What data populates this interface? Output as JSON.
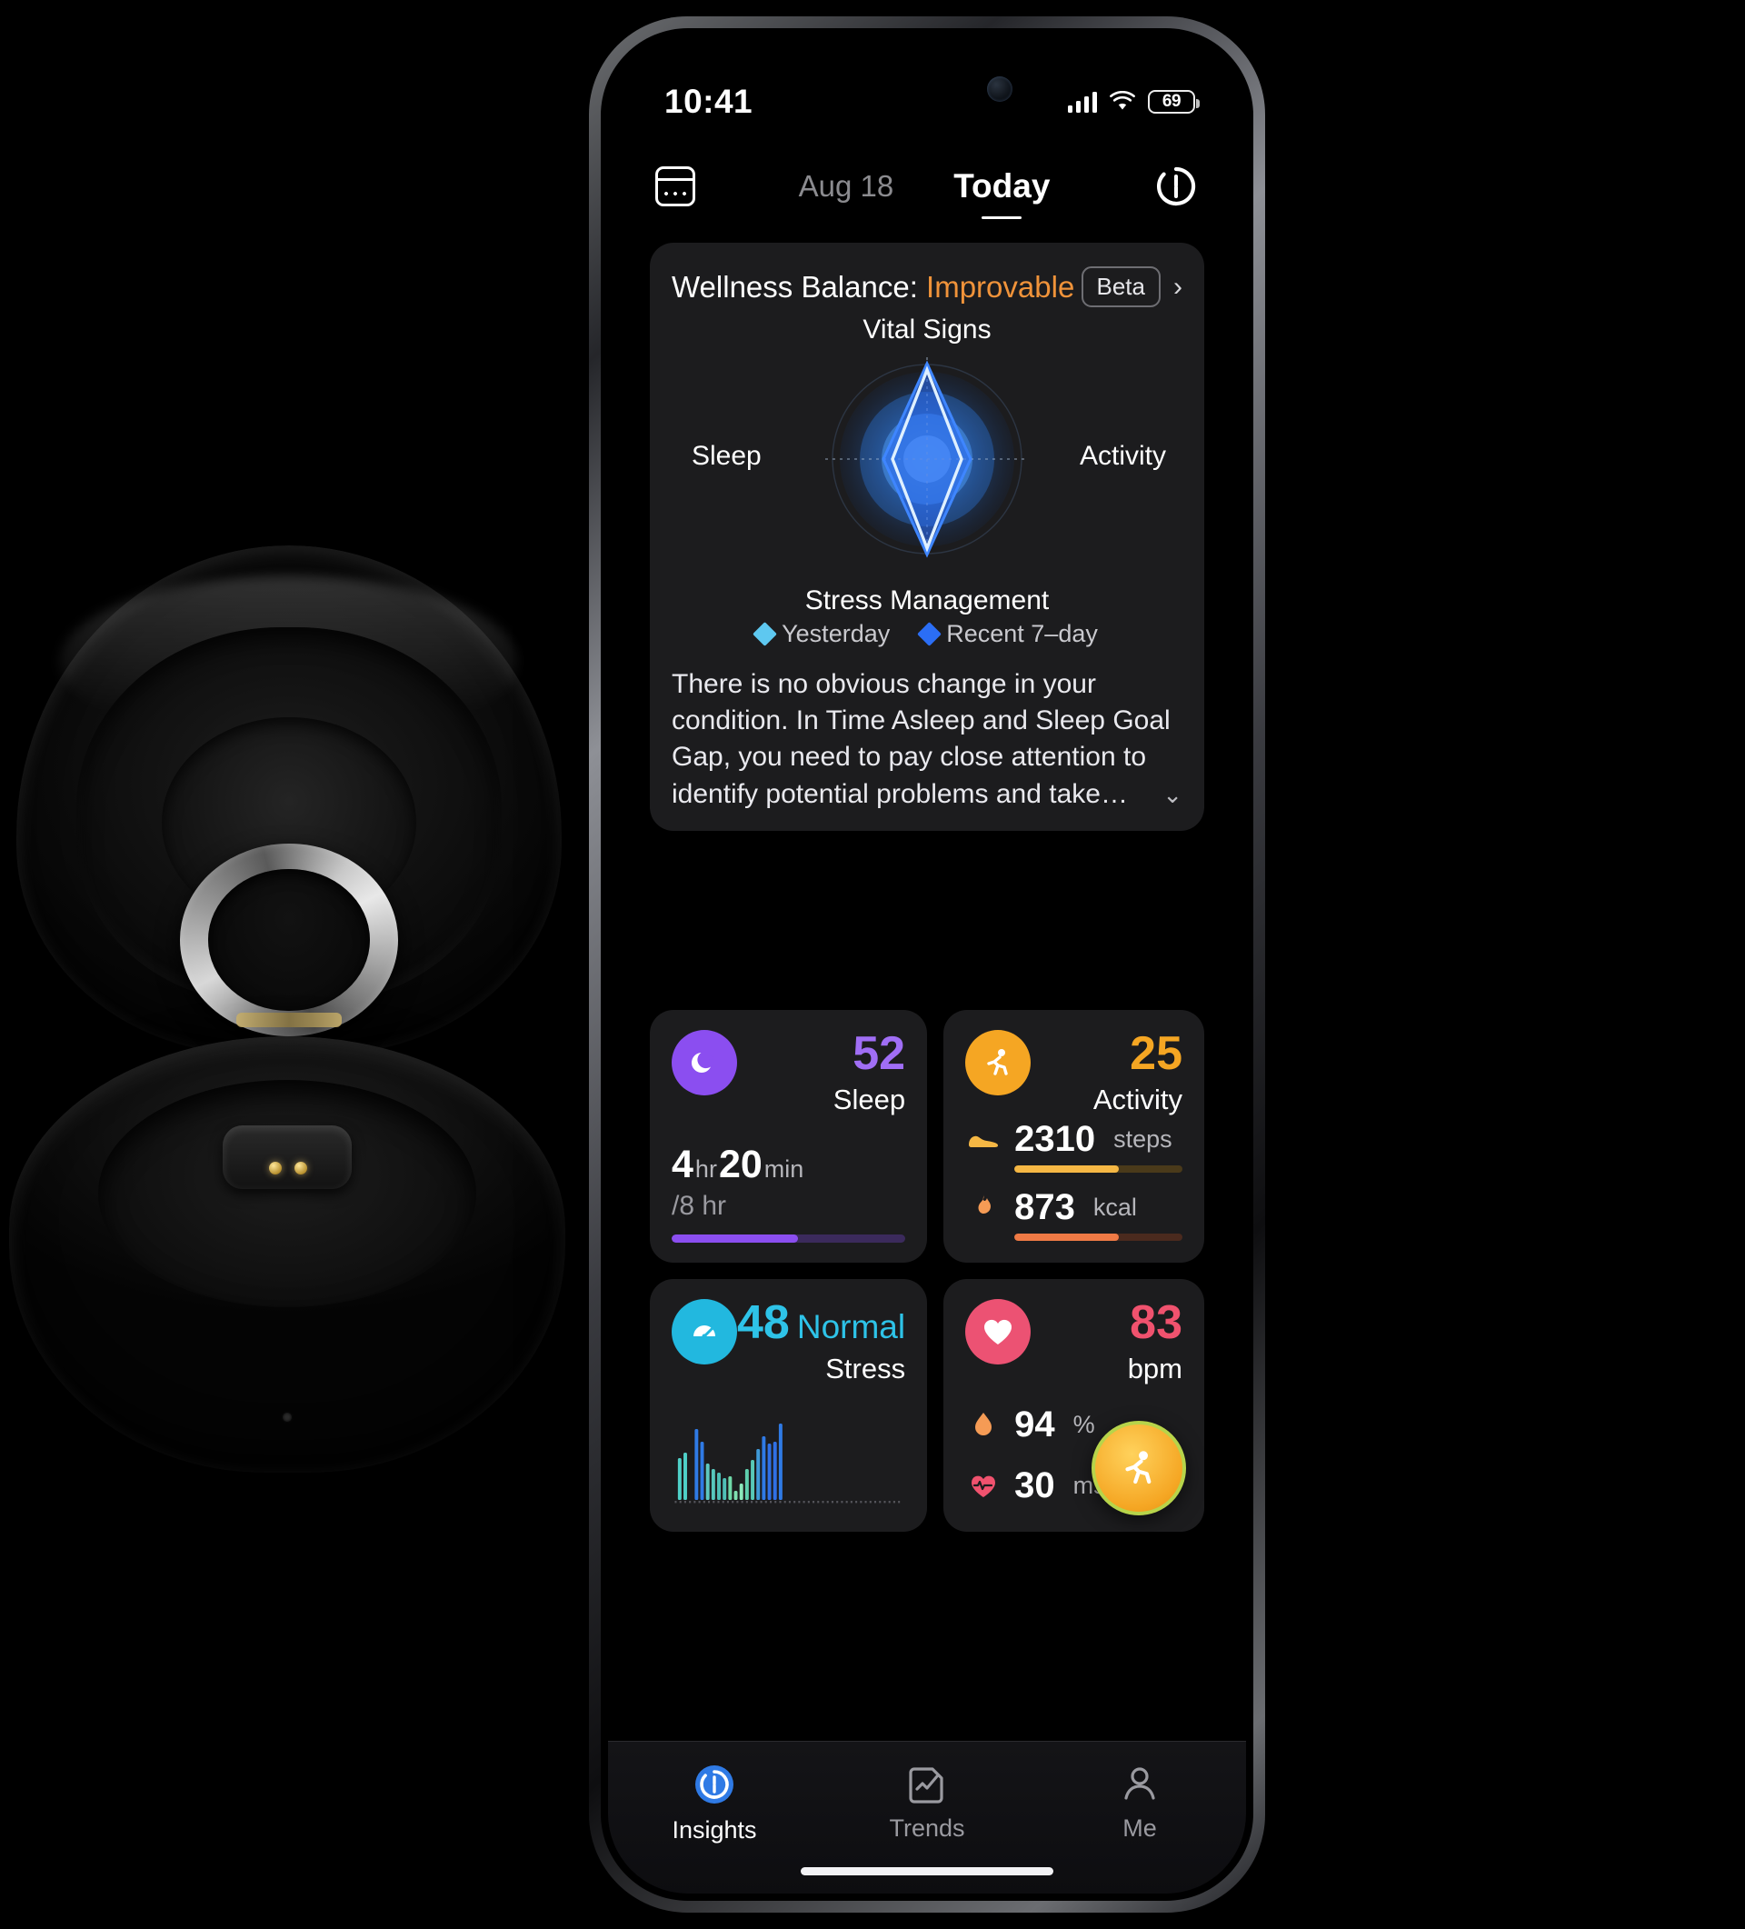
{
  "status_bar": {
    "time": "10:41",
    "battery": "69",
    "signal_icon": "cellular-bars-icon",
    "wifi_icon": "wifi-icon"
  },
  "nav": {
    "calendar_icon": "calendar-icon",
    "previous_date": "Aug 18",
    "current_tab": "Today",
    "sync_icon": "sync-refresh-icon"
  },
  "wellness": {
    "title_prefix": "Wellness Balance: ",
    "status": "Improvable",
    "status_color": "#f0933a",
    "beta_badge": "Beta",
    "chevron_right": "›",
    "chevron_down": "⌄",
    "axes": {
      "top": "Vital Signs",
      "right": "Activity",
      "bottom": "Stress Management",
      "left": "Sleep"
    },
    "legend": [
      {
        "label": "Yesterday",
        "color": "#5ec8f0"
      },
      {
        "label": "Recent 7–day",
        "color": "#2b6ef5"
      }
    ],
    "description": "There is no obvious change in your condition. In Time Asleep and Sleep Goal Gap, you need to pay close attention to identify potential problems and take…"
  },
  "chart_data": {
    "type": "radar",
    "title": "Wellness Balance",
    "categories": [
      "Vital Signs",
      "Activity",
      "Stress Management",
      "Sleep"
    ],
    "series": [
      {
        "name": "Yesterday",
        "color": "#5ec8f0",
        "values": [
          92,
          34,
          88,
          32
        ]
      },
      {
        "name": "Recent 7–day",
        "color": "#2b6ef5",
        "values": [
          80,
          44,
          78,
          42
        ]
      }
    ],
    "range": [
      0,
      100
    ],
    "grid": true,
    "legend_position": "bottom"
  },
  "metrics": {
    "sleep": {
      "icon": "moon-sleep-icon",
      "icon_color": "#8b4ef0",
      "score": "52",
      "label": "Sleep",
      "score_color": "#a06ef5",
      "duration_hours": "4",
      "duration_hours_unit": "hr",
      "duration_minutes": "20",
      "duration_minutes_unit": "min",
      "goal": "/8 hr",
      "progress_percent": 54,
      "bar_color": "#8b4ef0"
    },
    "activity": {
      "icon": "running-person-icon",
      "icon_color": "#f5a623",
      "score": "25",
      "label": "Activity",
      "score_color": "#f5a623",
      "rows": [
        {
          "icon": "shoe-icon",
          "value": "2310",
          "unit": "steps",
          "progress_percent": 62,
          "bar_color": "#f5b744"
        },
        {
          "icon": "flame-icon",
          "value": "873",
          "unit": "kcal",
          "progress_percent": 62,
          "bar_color": "#ef7a45"
        }
      ]
    },
    "stress": {
      "icon": "gauge-stress-icon",
      "icon_color": "#22b8df",
      "score": "48",
      "status": "Normal",
      "label": "Stress",
      "score_color": "#2ec3e8",
      "chart": {
        "type": "bar",
        "values": [
          46,
          52,
          0,
          78,
          64,
          40,
          34,
          30,
          24,
          26,
          10,
          18,
          34,
          44,
          56,
          70,
          62,
          64,
          84
        ],
        "colors": [
          "#4fd0c8",
          "#4fd0c8",
          "#000000",
          "#2f7ae5",
          "#2f7ae5",
          "#5ec8c0",
          "#57c7bd",
          "#4fbfb6",
          "#4fbfb6",
          "#6fd8a8",
          "#7fe0b0",
          "#8ae8bb",
          "#5fcfae",
          "#58c8b6",
          "#3f9ad8",
          "#2f7ae5",
          "#3070e5",
          "#3070e5",
          "#2f7ae5"
        ]
      }
    },
    "heart": {
      "icon": "heart-icon",
      "icon_color": "#ec5273",
      "score": "83",
      "label": "bpm",
      "score_color": "#f0526e",
      "rows": [
        {
          "icon": "blood-drop-icon",
          "value": "94",
          "unit": "%"
        },
        {
          "icon": "heart-pulse-icon",
          "value": "30",
          "unit": "ms"
        }
      ],
      "fab_icon": "workout-run-icon"
    }
  },
  "tabbar": {
    "items": [
      {
        "label": "Insights",
        "icon": "insights-ring-icon",
        "active": true
      },
      {
        "label": "Trends",
        "icon": "trends-chart-icon",
        "active": false
      },
      {
        "label": "Me",
        "icon": "person-icon",
        "active": false
      }
    ]
  }
}
